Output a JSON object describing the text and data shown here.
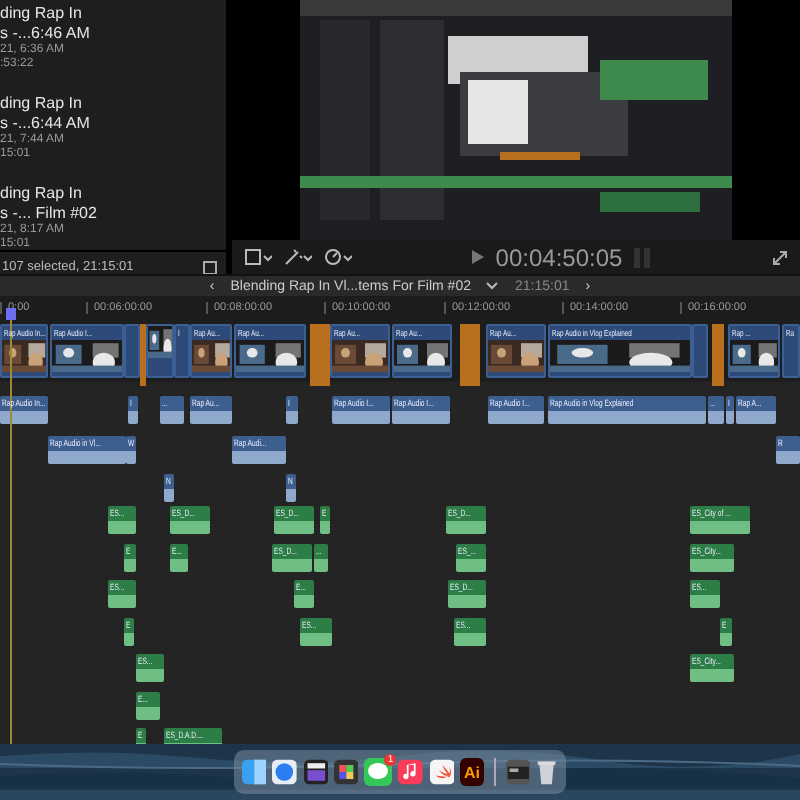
{
  "browser": {
    "entries": [
      {
        "lines": [
          "ding Rap In",
          "s -...6:46 AM",
          "21, 6:36 AM",
          ":53:22"
        ]
      },
      {
        "lines": [
          "ding Rap In",
          "s -...6:44 AM",
          "21, 7:44 AM",
          "15:01"
        ]
      },
      {
        "lines": [
          "ding Rap In",
          "s -... Film #02",
          "21, 8:17 AM",
          "15:01"
        ]
      }
    ],
    "status": "107 selected, 21:15:01"
  },
  "viewer": {
    "timecode": "00:04:50:05"
  },
  "timeline": {
    "prev": "‹",
    "title": "Blending Rap In Vl...tems For Film #02",
    "duration": "21:15:01",
    "next": "›",
    "ruler": [
      "0:00",
      "00:06:00:00",
      "00:08:00:00",
      "00:10:00:00",
      "00:12:00:00",
      "00:14:00:00",
      "00:16:00:00"
    ],
    "storyline": [
      {
        "kind": "clip",
        "label": "Rap Audio In..."
      },
      {
        "kind": "clip",
        "label": "Rap Audio I..."
      },
      {
        "kind": "clip"
      },
      {
        "kind": "transition"
      },
      {
        "kind": "clip"
      },
      {
        "kind": "clip",
        "label": "I"
      },
      {
        "kind": "clip",
        "label": "Rap Au..."
      },
      {
        "kind": "clip",
        "label": "Rap Au..."
      },
      {
        "kind": "transition"
      },
      {
        "kind": "clip",
        "label": "Rap Au..."
      },
      {
        "kind": "clip",
        "label": "Rap Au..."
      },
      {
        "kind": "transition"
      },
      {
        "kind": "clip",
        "label": "Rap Au..."
      },
      {
        "kind": "clip",
        "label": "Rap Audio in Vlog Explained"
      },
      {
        "kind": "clip"
      },
      {
        "kind": "transition"
      },
      {
        "kind": "clip",
        "label": "Rap ..."
      },
      {
        "kind": "clip",
        "label": "Ra"
      }
    ],
    "audio_lanes": [
      [
        "Rap Audio In...",
        "I",
        "...",
        "Rap Au...",
        "I",
        "Rap Audio I...",
        "Rap Audio I...",
        "Rap Audio I...",
        "Rap Audio in Vlog Explained",
        "...",
        "I",
        "Rap A..."
      ],
      [
        "Rap Audio in Vl...",
        "W",
        "Rap Audi...",
        "R"
      ],
      [
        "N",
        "N"
      ]
    ],
    "music_lanes": [
      [
        "ES...",
        "ES_D...",
        "ES_D...",
        "E",
        "ES_D...",
        "ES_City of ..."
      ],
      [
        "E",
        "E...",
        "ES_D...",
        "...",
        "ES_...",
        "ES_City..."
      ],
      [
        "ES...",
        "E...",
        "ES_D...",
        "ES..."
      ],
      [
        "E",
        "ES...",
        "ES...",
        "E"
      ],
      [
        "ES...",
        "ES_City..."
      ],
      [
        "E..."
      ],
      [
        "E",
        "ES_D.A.D...."
      ]
    ]
  },
  "dock": {
    "illustrator": "Ai",
    "badge": "1"
  }
}
